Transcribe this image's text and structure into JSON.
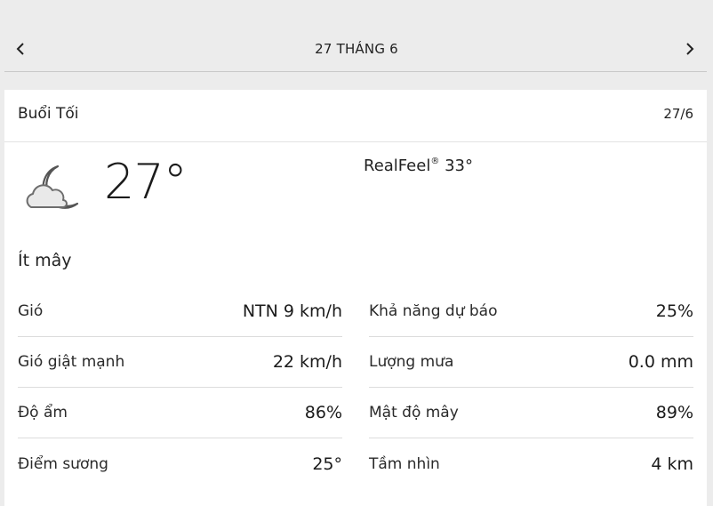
{
  "nav": {
    "title": "27 THÁNG 6",
    "prev_icon": "chevron-left-icon",
    "next_icon": "chevron-right-icon"
  },
  "card": {
    "period": "Buổi Tối",
    "date": "27/6",
    "icon": "partly-cloudy-night-icon",
    "temperature": "27°",
    "realfeel_label": "RealFeel",
    "realfeel_mark": "®",
    "realfeel_value": "33°",
    "phrase": "Ít mây"
  },
  "details_left": [
    {
      "label": "Gió",
      "value": "NTN 9 km/h"
    },
    {
      "label": "Gió giật mạnh",
      "value": "22 km/h"
    },
    {
      "label": "Độ ẩm",
      "value": "86%"
    },
    {
      "label": "Điểm sương",
      "value": "25°"
    }
  ],
  "details_right": [
    {
      "label": "Khả năng dự báo",
      "value": "25%"
    },
    {
      "label": "Lượng mưa",
      "value": "0.0 mm"
    },
    {
      "label": "Mật độ mây",
      "value": "89%"
    },
    {
      "label": "Tầm nhìn",
      "value": "4 km"
    }
  ]
}
